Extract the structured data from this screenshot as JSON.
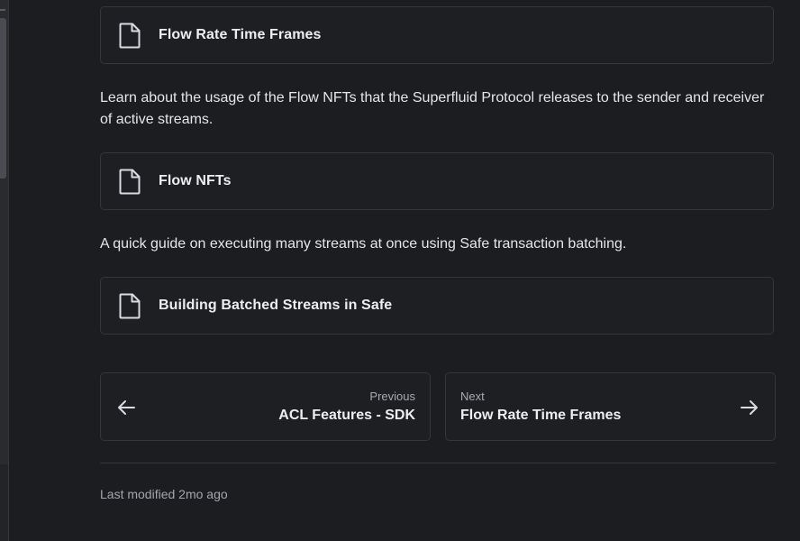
{
  "cards": [
    {
      "title": "Flow Rate Time Frames",
      "icon": "file-icon"
    },
    {
      "title": "Flow NFTs",
      "icon": "file-icon"
    },
    {
      "title": "Building Batched Streams in Safe",
      "icon": "file-icon"
    }
  ],
  "descriptions": [
    "Learn about the usage of the Flow NFTs that the Superfluid Protocol releases to the sender and receiver of active streams.",
    "A quick guide on executing many streams at once using Safe transaction batching."
  ],
  "pagination": {
    "previous": {
      "kicker": "Previous",
      "label": "ACL Features - SDK",
      "icon": "arrow-left-icon"
    },
    "next": {
      "kicker": "Next",
      "label": "Flow Rate Time Frames",
      "icon": "arrow-right-icon"
    }
  },
  "footer": {
    "last_modified": "Last modified 2mo ago"
  },
  "colors": {
    "background": "#1c1d21",
    "card_border": "#34363c",
    "text_primary": "#eceef1",
    "text_muted": "#a3a6ad"
  }
}
